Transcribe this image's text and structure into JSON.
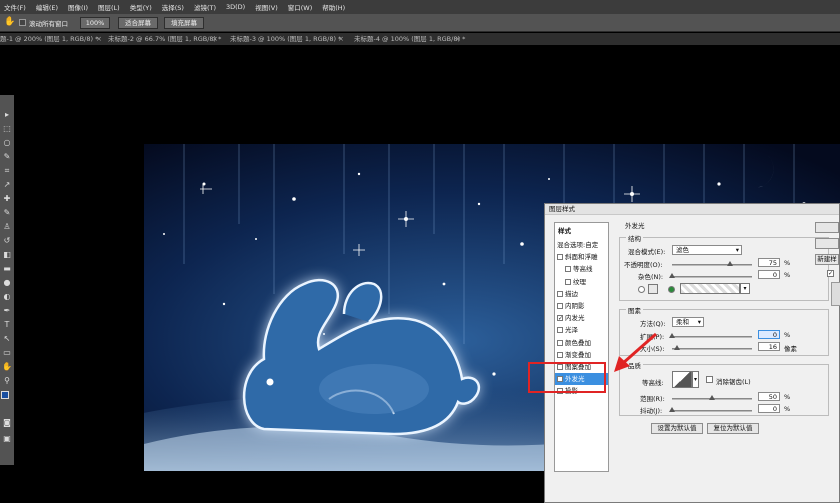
{
  "menu": [
    "文件(F)",
    "编辑(E)",
    "图像(I)",
    "图层(L)",
    "类型(Y)",
    "选择(S)",
    "滤镜(T)",
    "3D(D)",
    "视图(V)",
    "窗口(W)",
    "帮助(H)"
  ],
  "options": {
    "scroll_all_label": "滚动所有窗口",
    "zoom": "100%",
    "fit_label": "适合屏幕",
    "fill_label": "填充屏幕"
  },
  "tabs": [
    "题-1 @ 200% (图层 1, RGB/8) *",
    "未标题-2 @ 66.7% (图层 1, RGB/8) *",
    "未标题-3 @ 100% (图层 1, RGB/8) *",
    "未标题-4 @ 100% (图层 1, RGB/8) *"
  ],
  "dialog": {
    "title": "图层样式",
    "styles_header": "样式",
    "styles": [
      {
        "label": "混合选项:自定",
        "checked": null,
        "indent": false,
        "selected": false
      },
      {
        "label": "斜面和浮雕",
        "checked": false,
        "indent": false,
        "selected": false
      },
      {
        "label": "等高线",
        "checked": false,
        "indent": true,
        "selected": false
      },
      {
        "label": "纹理",
        "checked": false,
        "indent": true,
        "selected": false
      },
      {
        "label": "描边",
        "checked": false,
        "indent": false,
        "selected": false
      },
      {
        "label": "内阴影",
        "checked": false,
        "indent": false,
        "selected": false
      },
      {
        "label": "内发光",
        "checked": true,
        "indent": false,
        "selected": false
      },
      {
        "label": "光泽",
        "checked": false,
        "indent": false,
        "selected": false
      },
      {
        "label": "颜色叠加",
        "checked": false,
        "indent": false,
        "selected": false
      },
      {
        "label": "渐变叠加",
        "checked": false,
        "indent": false,
        "selected": false
      },
      {
        "label": "图案叠加",
        "checked": false,
        "indent": false,
        "selected": false
      },
      {
        "label": "外发光",
        "checked": true,
        "indent": false,
        "selected": true
      },
      {
        "label": "投影",
        "checked": false,
        "indent": false,
        "selected": false
      }
    ],
    "outer_glow": "外发光",
    "structure": "结构",
    "blend_mode_label": "混合模式(E):",
    "blend_mode_value": "滤色",
    "opacity_label": "不透明度(O):",
    "opacity_value": "75",
    "noise_label": "杂色(N):",
    "noise_value": "0",
    "percent": "%",
    "elements": "图素",
    "technique_label": "方法(Q):",
    "technique_value": "柔和",
    "spread_label": "扩展(P):",
    "spread_value": "0",
    "size_label": "大小(S):",
    "size_value": "16",
    "pixels": "像素",
    "quality": "品质",
    "contour_label": "等高线:",
    "antialias_label": "消除锯齿(L)",
    "range_label": "范围(R):",
    "range_value": "50",
    "jitter_label": "抖动(J):",
    "jitter_value": "0",
    "make_default": "设置为默认值",
    "reset_default": "复位为默认值",
    "new_style_partial": "新建样"
  },
  "colors": {
    "glow": "#cfe4ff",
    "accent": "#e02424",
    "selected": "#3b8fe0"
  }
}
